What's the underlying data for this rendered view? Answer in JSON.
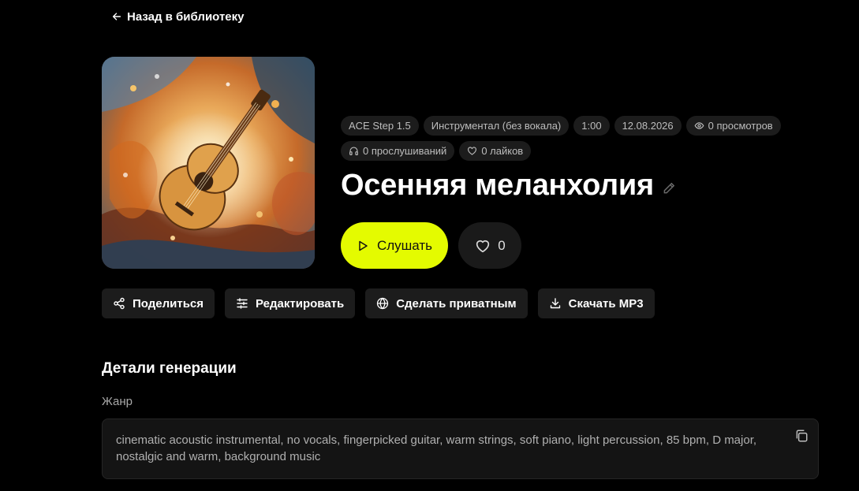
{
  "nav": {
    "back_label": "Назад в библиотеку"
  },
  "track": {
    "title": "Осенняя меланхолия",
    "chips": {
      "model": "ACE Step 1.5",
      "type": "Инструментал (без вокала)",
      "duration": "1:00",
      "date": "12.08.2026",
      "views": "0 просмотров",
      "listens": "0 прослушиваний",
      "likes": "0 лайков"
    }
  },
  "player": {
    "listen_label": "Слушать",
    "like_count": "0"
  },
  "actions": {
    "share": "Поделиться",
    "edit": "Редактировать",
    "private": "Сделать приватным",
    "download": "Скачать MP3"
  },
  "details": {
    "heading": "Детали генерации",
    "genre_label": "Жанр",
    "genre_text": "cinematic acoustic instrumental, no vocals, fingerpicked guitar, warm strings, soft piano, light percussion, 85 bpm, D major, nostalgic and warm, background music"
  },
  "colors": {
    "accent": "#e4fb00",
    "background": "#000000",
    "chip": "#1c1c1c"
  },
  "icons": [
    "arrow-left-icon",
    "eye-icon",
    "headphones-icon",
    "heart-icon",
    "pencil-icon",
    "play-icon",
    "share-icon",
    "sliders-icon",
    "globe-icon",
    "download-icon",
    "copy-icon"
  ]
}
